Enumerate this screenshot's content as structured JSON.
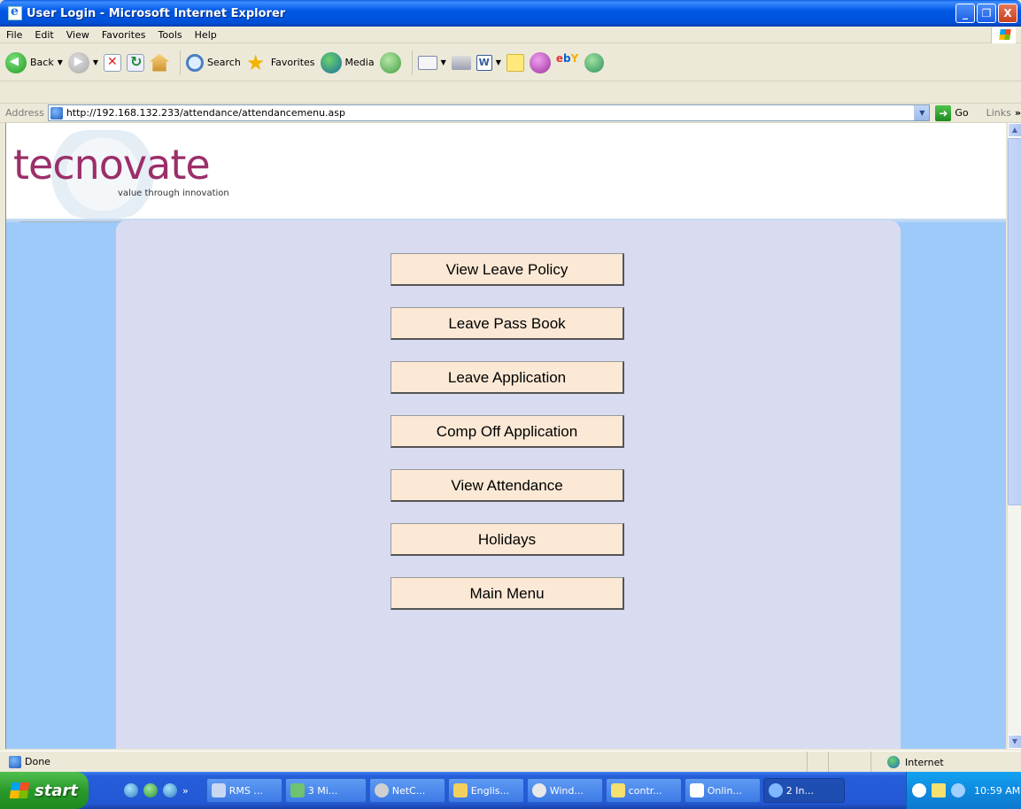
{
  "window": {
    "title": "User Login - Microsoft Internet Explorer",
    "minimize": "_",
    "maximize": "❐",
    "close": "X"
  },
  "menubar": [
    "File",
    "Edit",
    "View",
    "Favorites",
    "Tools",
    "Help"
  ],
  "toolbar": {
    "back": "Back",
    "search": "Search",
    "favorites": "Favorites",
    "media": "Media",
    "word_icon": "W",
    "ebay_e": "e",
    "ebay_b": "b",
    "ebay_y": "Y"
  },
  "address": {
    "label": "Address",
    "url": "http://192.168.132.233/attendance/attendancemenu.asp",
    "go": "Go",
    "links": "Links",
    "links_more": "»"
  },
  "page": {
    "logo_text": "tecnovate",
    "logo_tagline": "value through innovation",
    "menu_buttons": [
      "View Leave Policy",
      "Leave Pass Book",
      "Leave Application",
      "Comp Off Application",
      "View Attendance",
      "Holidays",
      "Main Menu"
    ]
  },
  "status": {
    "text": "Done",
    "zone": "Internet"
  },
  "taskbar": {
    "start": "start",
    "tasks": [
      "RMS ...",
      "3 Mi...",
      "NetC...",
      "Englis...",
      "Wind...",
      "contr...",
      "Onlin...",
      "2 In..."
    ],
    "clock": "10:59 AM",
    "quick_more": "»"
  },
  "colors": {
    "page_background": "#9ecafa",
    "panel": "#d9dcf0",
    "button_fill": "#fbe9d6",
    "logo": "#9b2f6a",
    "titlebar": "#0058e6",
    "taskbar": "#245edb",
    "start_button": "#2a9a2a"
  }
}
